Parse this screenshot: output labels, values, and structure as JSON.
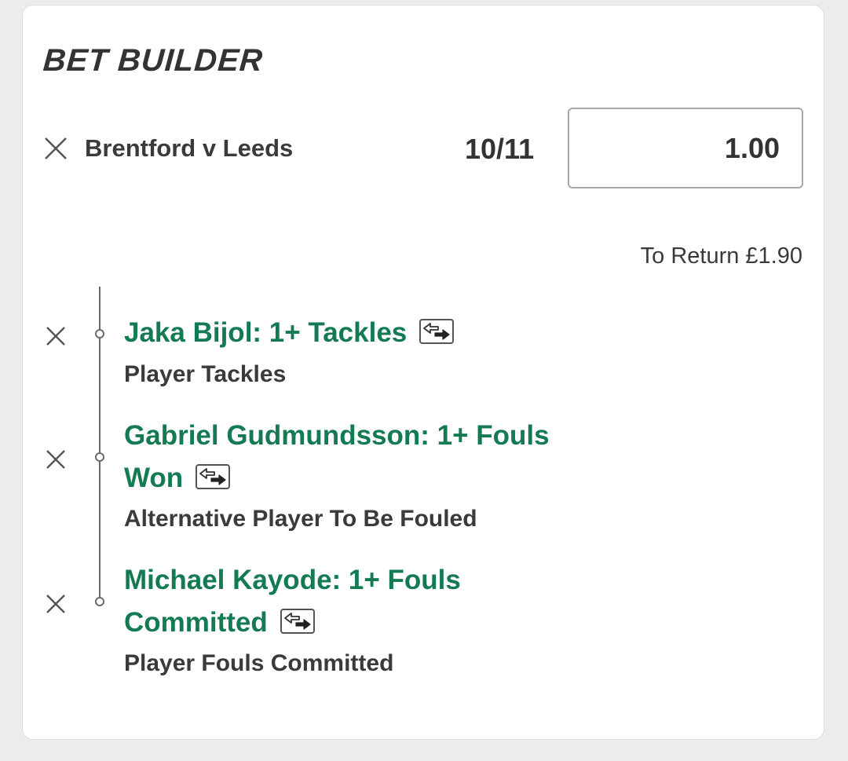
{
  "header": {
    "title": "BET BUILDER"
  },
  "bet": {
    "match": "Brentford v Leeds",
    "odds": "10/11",
    "stake": "1.00",
    "to_return": "To Return £1.90"
  },
  "selections": [
    {
      "title": "Jaka Bijol: 1+ Tackles",
      "market": "Player Tackles"
    },
    {
      "title": "Gabriel Gudmundsson: 1+ Fouls Won",
      "market": "Alternative Player To Be Fouled"
    },
    {
      "title": "Michael Kayode: 1+ Fouls Committed",
      "market": "Player Fouls Committed"
    }
  ],
  "icons": {
    "remove": "close-icon",
    "swap": "swap-icon"
  },
  "colors": {
    "selection_green": "#137a52",
    "text_dark": "#3a3a3a",
    "background": "#ececec"
  }
}
